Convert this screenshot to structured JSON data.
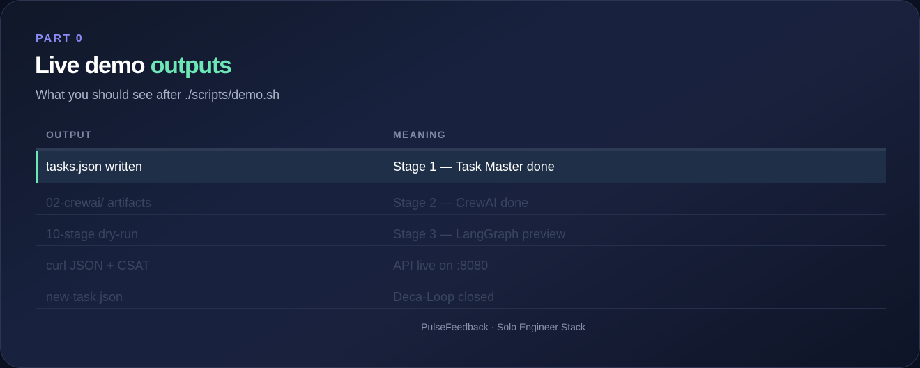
{
  "header": {
    "eyebrow": "PART 0",
    "title_main": "Live demo ",
    "title_accent": "outputs",
    "subtitle": "What you should see after ./scripts/demo.sh"
  },
  "table": {
    "columns": [
      "OUTPUT",
      "MEANING"
    ],
    "rows": [
      {
        "output": "tasks.json written",
        "meaning": "Stage 1 — Task Master done",
        "state": "active"
      },
      {
        "output": "02-crewai/ artifacts",
        "meaning": "Stage 2 — CrewAI done",
        "state": "pending"
      },
      {
        "output": "10-stage dry-run",
        "meaning": "Stage 3 — LangGraph preview",
        "state": "pending"
      },
      {
        "output": "curl JSON + CSAT",
        "meaning": "API live on :8080",
        "state": "pending"
      },
      {
        "output": "new-task.json",
        "meaning": "Deca-Loop closed",
        "state": "pending"
      }
    ]
  },
  "footer": {
    "text": "PulseFeedback · Solo Engineer Stack"
  },
  "colors": {
    "accent_green": "#6ee7b7",
    "accent_purple": "#8b8cf6",
    "background": "#141c33"
  }
}
